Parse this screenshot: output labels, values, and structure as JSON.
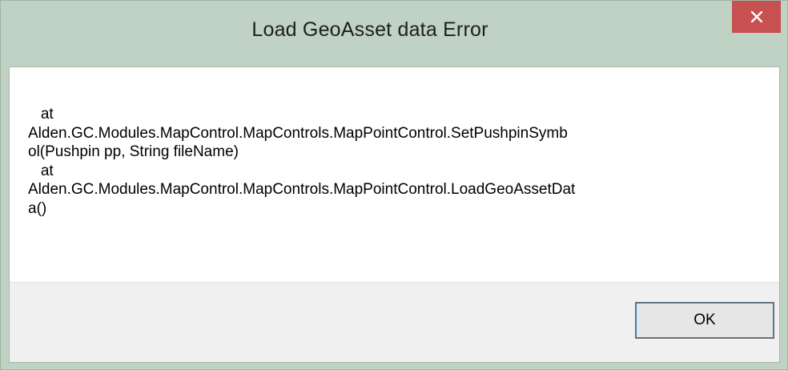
{
  "window": {
    "title": "Load GeoAsset data Error",
    "close_icon": "close-icon"
  },
  "message": {
    "lines": [
      "   at",
      "Alden.GC.Modules.MapControl.MapControls.MapPointControl.SetPushpinSymb",
      "ol(Pushpin pp, String fileName)",
      "   at",
      "Alden.GC.Modules.MapControl.MapControls.MapPointControl.LoadGeoAssetDat",
      "a()"
    ]
  },
  "buttons": {
    "ok_label": "OK"
  },
  "colors": {
    "frame": "#bfd2c4",
    "close_button": "#c75050",
    "button_area": "#f0f0f0"
  }
}
